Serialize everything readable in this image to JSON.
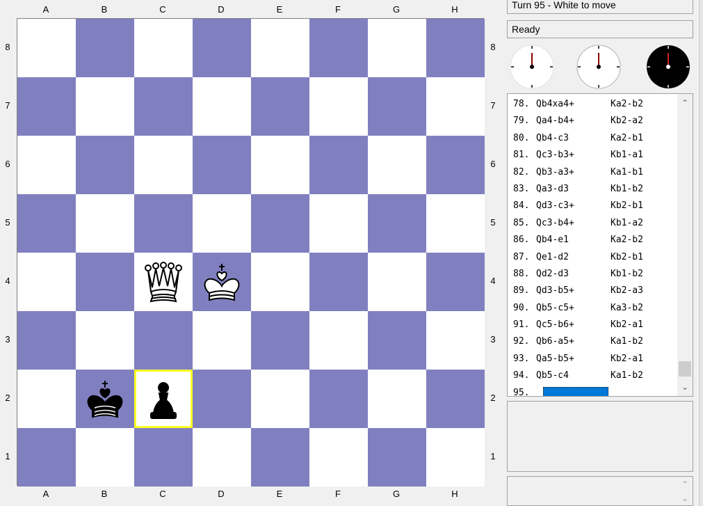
{
  "board": {
    "files": [
      "A",
      "B",
      "C",
      "D",
      "E",
      "F",
      "G",
      "H"
    ],
    "ranks": [
      "8",
      "7",
      "6",
      "5",
      "4",
      "3",
      "2",
      "1"
    ],
    "light_color": "#ffffff",
    "dark_color": "#8080c0",
    "highlight_color": "#ffff22",
    "highlight_square": "c2",
    "pieces": [
      {
        "square": "c4",
        "type": "queen",
        "color": "white",
        "icon": "white-queen-icon"
      },
      {
        "square": "d4",
        "type": "king",
        "color": "white",
        "icon": "white-king-icon"
      },
      {
        "square": "b2",
        "type": "king",
        "color": "black",
        "icon": "black-king-icon"
      },
      {
        "square": "c2",
        "type": "pawn",
        "color": "black",
        "icon": "black-pawn-icon"
      }
    ]
  },
  "status": {
    "turn": "Turn 95 - White to move",
    "engine": "Ready"
  },
  "clocks": [
    {
      "name": "white-clock",
      "face": "#ffffff",
      "hand": "#8b0000"
    },
    {
      "name": "game-clock",
      "face": "#ffffff",
      "hand": "#8b0000"
    },
    {
      "name": "black-clock",
      "face": "#000000",
      "hand": "#8b0000"
    }
  ],
  "moves": [
    {
      "num": "78.",
      "white": "Qb4xa4+",
      "black": "Ka2-b2"
    },
    {
      "num": "79.",
      "white": "Qa4-b4+",
      "black": "Kb2-a2"
    },
    {
      "num": "80.",
      "white": "Qb4-c3",
      "black": "Ka2-b1"
    },
    {
      "num": "81.",
      "white": "Qc3-b3+",
      "black": "Kb1-a1"
    },
    {
      "num": "82.",
      "white": "Qb3-a3+",
      "black": "Ka1-b1"
    },
    {
      "num": "83.",
      "white": "Qa3-d3",
      "black": "Kb1-b2"
    },
    {
      "num": "84.",
      "white": "Qd3-c3+",
      "black": "Kb2-b1"
    },
    {
      "num": "85.",
      "white": "Qc3-b4+",
      "black": "Kb1-a2"
    },
    {
      "num": "86.",
      "white": "Qb4-e1",
      "black": "Ka2-b2"
    },
    {
      "num": "87.",
      "white": "Qe1-d2",
      "black": "Kb2-b1"
    },
    {
      "num": "88.",
      "white": "Qd2-d3",
      "black": "Kb1-b2"
    },
    {
      "num": "89.",
      "white": "Qd3-b5+",
      "black": "Kb2-a3"
    },
    {
      "num": "90.",
      "white": "Qb5-c5+",
      "black": "Ka3-b2"
    },
    {
      "num": "91.",
      "white": "Qc5-b6+",
      "black": "Kb2-a1"
    },
    {
      "num": "92.",
      "white": "Qb6-a5+",
      "black": "Ka1-b2"
    },
    {
      "num": "93.",
      "white": "Qa5-b5+",
      "black": "Kb2-a1"
    },
    {
      "num": "94.",
      "white": "Qb5-c4",
      "black": "Ka1-b2"
    },
    {
      "num": "95.",
      "white": "",
      "black": ""
    }
  ],
  "move_scroll": {
    "up_icon": "chevron-up-icon",
    "down_icon": "chevron-down-icon"
  },
  "input_scroll": {
    "up_icon": "chevron-up-icon",
    "down_icon": "chevron-down-icon"
  }
}
